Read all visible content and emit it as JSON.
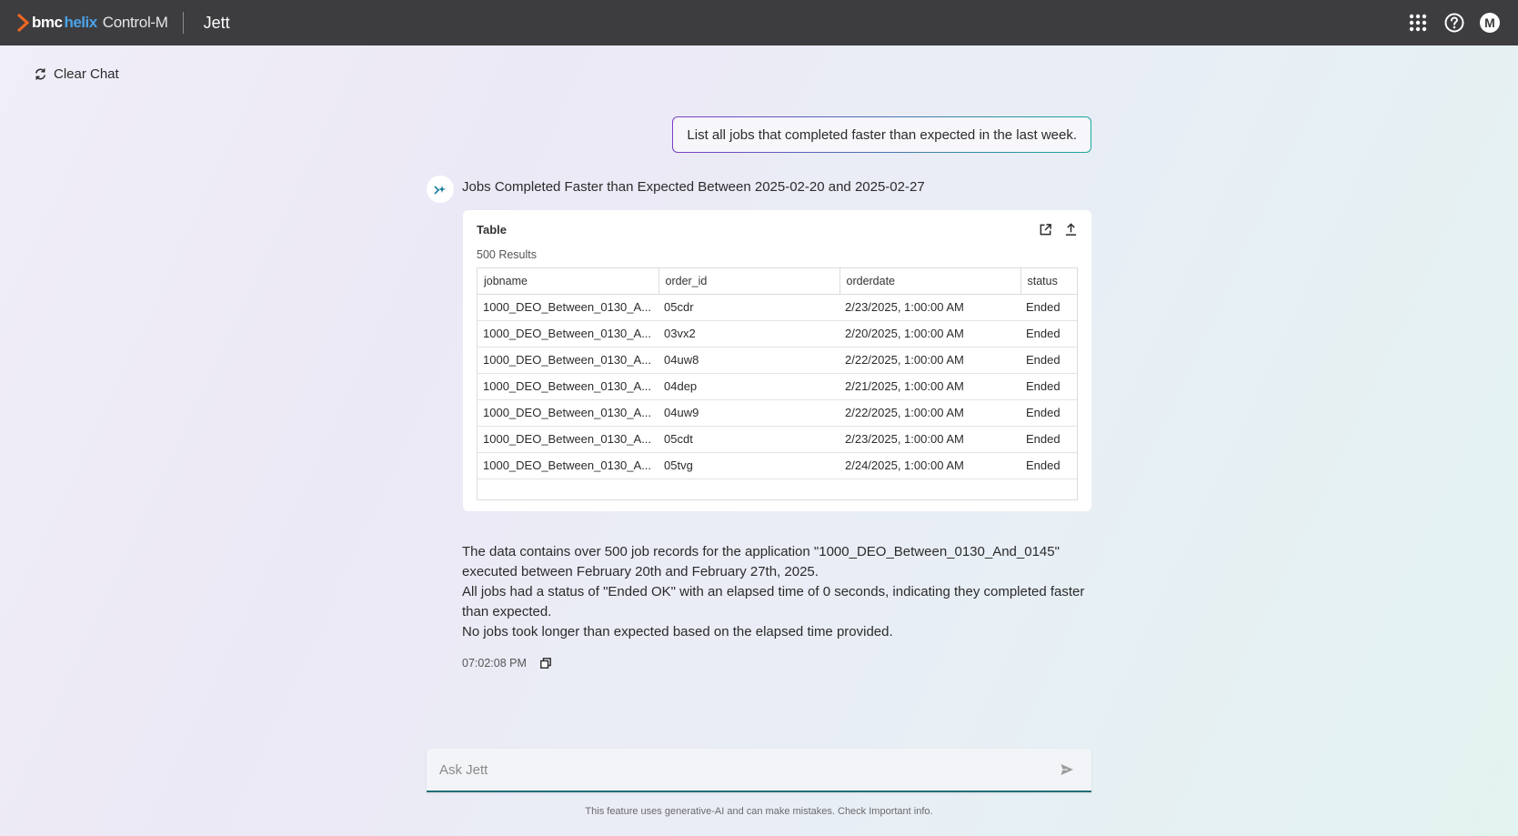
{
  "header": {
    "brand_bmc": "bmc",
    "brand_helix": "helix",
    "brand_product": "Control-M",
    "app_name": "Jett",
    "avatar_initial": "M",
    "icons": [
      "apps-grid-icon",
      "help-icon",
      "user-avatar"
    ]
  },
  "toolbar": {
    "clear_chat_label": "Clear Chat"
  },
  "conversation": {
    "user_message": "List all jobs that completed faster than expected in the last week.",
    "bot_title": "Jobs Completed Faster than Expected Between 2025-02-20 and 2025-02-27",
    "table_card": {
      "title": "Table",
      "results": "500 Results",
      "columns": [
        "jobname",
        "order_id",
        "orderdate",
        "status"
      ],
      "rows": [
        [
          "1000_DEO_Between_0130_A...",
          "05cdr",
          "2/23/2025, 1:00:00 AM",
          "Ended"
        ],
        [
          "1000_DEO_Between_0130_A...",
          "03vx2",
          "2/20/2025, 1:00:00 AM",
          "Ended"
        ],
        [
          "1000_DEO_Between_0130_A...",
          "04uw8",
          "2/22/2025, 1:00:00 AM",
          "Ended"
        ],
        [
          "1000_DEO_Between_0130_A...",
          "04dep",
          "2/21/2025, 1:00:00 AM",
          "Ended"
        ],
        [
          "1000_DEO_Between_0130_A...",
          "04uw9",
          "2/22/2025, 1:00:00 AM",
          "Ended"
        ],
        [
          "1000_DEO_Between_0130_A...",
          "05cdt",
          "2/23/2025, 1:00:00 AM",
          "Ended"
        ],
        [
          "1000_DEO_Between_0130_A...",
          "05tvg",
          "2/24/2025, 1:00:00 AM",
          "Ended"
        ]
      ]
    },
    "summary": [
      "The data contains over 500 job records for the application \"1000_DEO_Between_0130_And_0145\" executed between February 20th and February 27th, 2025.",
      "All jobs had a status of \"Ended OK\" with an elapsed time of 0 seconds, indicating they completed faster than expected.",
      "No jobs took longer than expected based on the elapsed time provided."
    ],
    "timestamp": "07:02:08 PM"
  },
  "input": {
    "placeholder": "Ask Jett"
  },
  "footer": {
    "disclaimer": "This feature uses generative-AI and can make mistakes. Check Important info."
  },
  "colors": {
    "topbar": "#3d3d40",
    "brand_accent": "#f26722",
    "helix_blue": "#4aa3e8",
    "input_underline": "#1f6f78"
  }
}
